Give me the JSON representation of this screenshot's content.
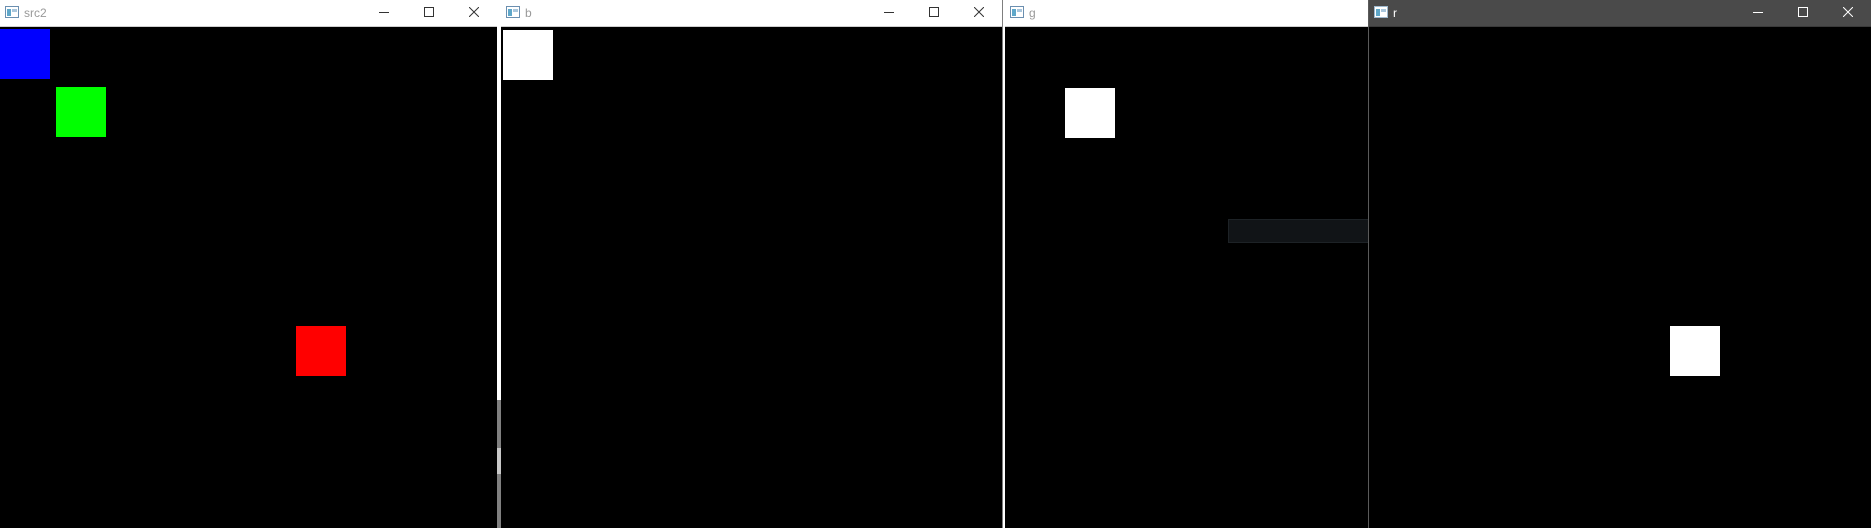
{
  "windows": [
    {
      "title": "src2",
      "active": false,
      "squares": [
        {
          "color": "#0000ff",
          "name": "blue-square"
        },
        {
          "color": "#00ff00",
          "name": "green-square"
        },
        {
          "color": "#ff0000",
          "name": "red-square"
        }
      ]
    },
    {
      "title": "b",
      "active": false,
      "squares": [
        {
          "color": "#ffffff",
          "name": "white-square"
        }
      ]
    },
    {
      "title": "g",
      "active": false,
      "squares": [
        {
          "color": "#ffffff",
          "name": "white-square"
        }
      ]
    },
    {
      "title": "r",
      "active": true,
      "squares": [
        {
          "color": "#ffffff",
          "name": "white-square"
        }
      ]
    }
  ],
  "controls": {
    "minimize_icon": "minimize-icon",
    "maximize_icon": "maximize-icon",
    "close_icon": "close-icon"
  },
  "colors": {
    "canvas": "#000000",
    "titlebar_inactive": "#ffffff",
    "titlebar_active": "#4a4a4a"
  }
}
